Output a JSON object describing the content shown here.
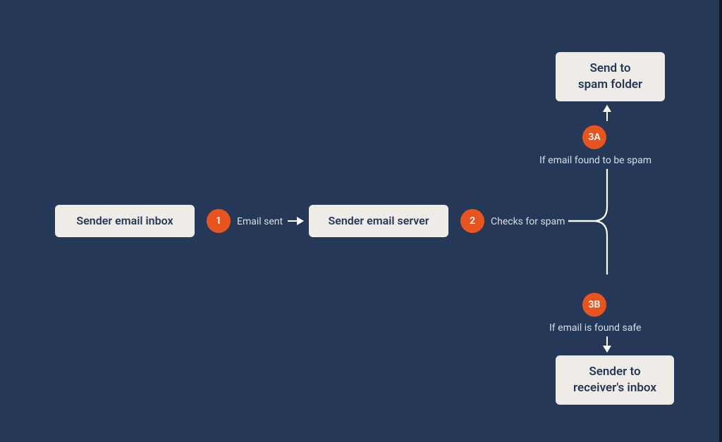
{
  "colors": {
    "background": "#253858",
    "node_bg": "#efece8",
    "node_text": "#253858",
    "accent": "#e8541e",
    "line": "#ffffff",
    "label": "#d8dde6"
  },
  "nodes": {
    "inbox": {
      "label": "Sender email inbox"
    },
    "server": {
      "label": "Sender email server"
    },
    "spam": {
      "label": "Send to\nspam folder"
    },
    "safe": {
      "label": "Sender to\nreceiver's inbox"
    }
  },
  "steps": {
    "s1": {
      "num": "1",
      "label": "Email sent"
    },
    "s2": {
      "num": "2",
      "label": "Checks for spam"
    },
    "s3a": {
      "num": "3A",
      "label": "If email found to be spam"
    },
    "s3b": {
      "num": "3B",
      "label": "If email is found safe"
    }
  }
}
